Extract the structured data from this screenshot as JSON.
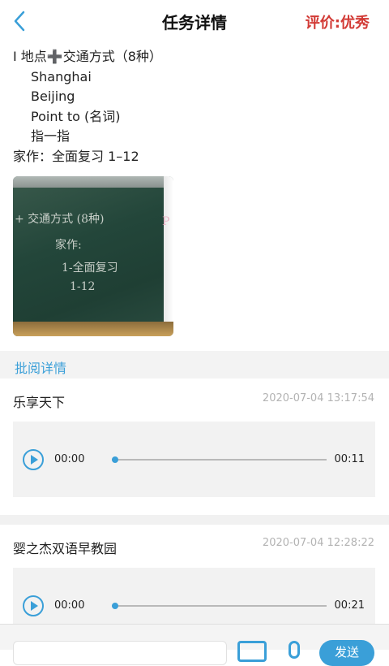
{
  "header": {
    "title": "任务详情",
    "rating": "评价:优秀",
    "back_icon": "chevron-left-icon",
    "accent_color": "#3a9fd8",
    "rating_color": "#d23a35"
  },
  "task": {
    "lines": [
      "I   地点➕交通方式（8种）",
      "Shanghai",
      "Beijing",
      "Point to (名词)",
      "指一指",
      "家作：全面复习 1–12"
    ]
  },
  "section": {
    "title": "批阅详情"
  },
  "reviews": [
    {
      "name": "乐享天下",
      "time": "2020-07-04 13:17:54",
      "current": "00:00",
      "duration": "00:11",
      "progress": 0
    },
    {
      "name": "婴之杰双语早教园",
      "time": "2020-07-04 12:28:22",
      "current": "00:00",
      "duration": "00:21",
      "progress": 0
    }
  ],
  "bottom": {
    "send_label": "发送",
    "image_icon": "image-icon",
    "mic_icon": "microphone-icon"
  }
}
